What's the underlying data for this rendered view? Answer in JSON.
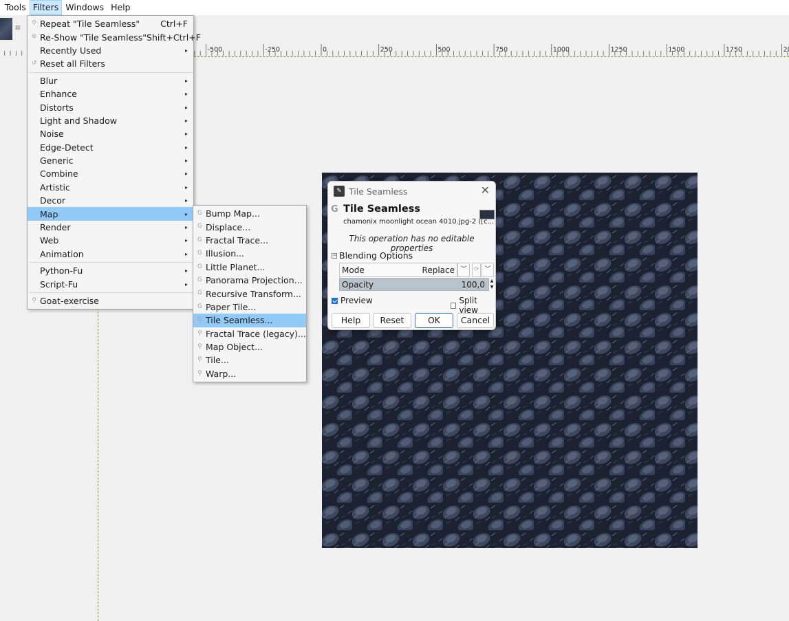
{
  "menubar": {
    "items": [
      "Tools",
      "Filters",
      "Windows",
      "Help"
    ]
  },
  "ruler": {
    "labels": [
      "-500",
      "-250",
      "0",
      "250",
      "500",
      "750",
      "1000",
      "1250",
      "1500",
      "1750",
      "20"
    ]
  },
  "filters_menu": {
    "repeat_label": "Repeat \"Tile Seamless\"",
    "repeat_shortcut": "Ctrl+F",
    "reshow_label": "Re-Show \"Tile Seamless\"",
    "reshow_shortcut": "Shift+Ctrl+F",
    "recently_used": "Recently Used",
    "reset_all": "Reset all Filters",
    "categories": [
      "Blur",
      "Enhance",
      "Distorts",
      "Light and Shadow",
      "Noise",
      "Edge-Detect",
      "Generic",
      "Combine",
      "Artistic",
      "Decor",
      "Map",
      "Render",
      "Web",
      "Animation"
    ],
    "scripts": [
      "Python-Fu",
      "Script-Fu"
    ],
    "goat": "Goat-exercise"
  },
  "map_menu": {
    "items": [
      "Bump Map...",
      "Displace...",
      "Fractal Trace...",
      "Illusion...",
      "Little Planet...",
      "Panorama Projection...",
      "Recursive Transform...",
      "Paper Tile...",
      "Tile Seamless...",
      "Fractal Trace (legacy)...",
      "Map Object...",
      "Tile...",
      "Warp..."
    ],
    "highlighted": "Tile Seamless..."
  },
  "dialog": {
    "window_title": "Tile Seamless",
    "heading": "Tile Seamless",
    "subtitle": "chamonix moonlight ocean 4010.jpg-2 ([c...",
    "note": "This operation has no editable properties",
    "blending_options": "Blending Options",
    "mode_label": "Mode",
    "mode_value": "Replace",
    "opacity_label": "Opacity",
    "opacity_value": "100,0",
    "preview_label": "Preview",
    "preview_checked": true,
    "split_view_label": "Split view",
    "split_view_checked": false,
    "buttons": {
      "help": "Help",
      "reset": "Reset",
      "ok": "OK",
      "cancel": "Cancel"
    }
  },
  "colors": {
    "menu_highlight": "#91c9f7",
    "menubar_open": "#cce8ff",
    "opacity_bar": "#b9c3cc",
    "canvas_texture": "#2a3142"
  }
}
